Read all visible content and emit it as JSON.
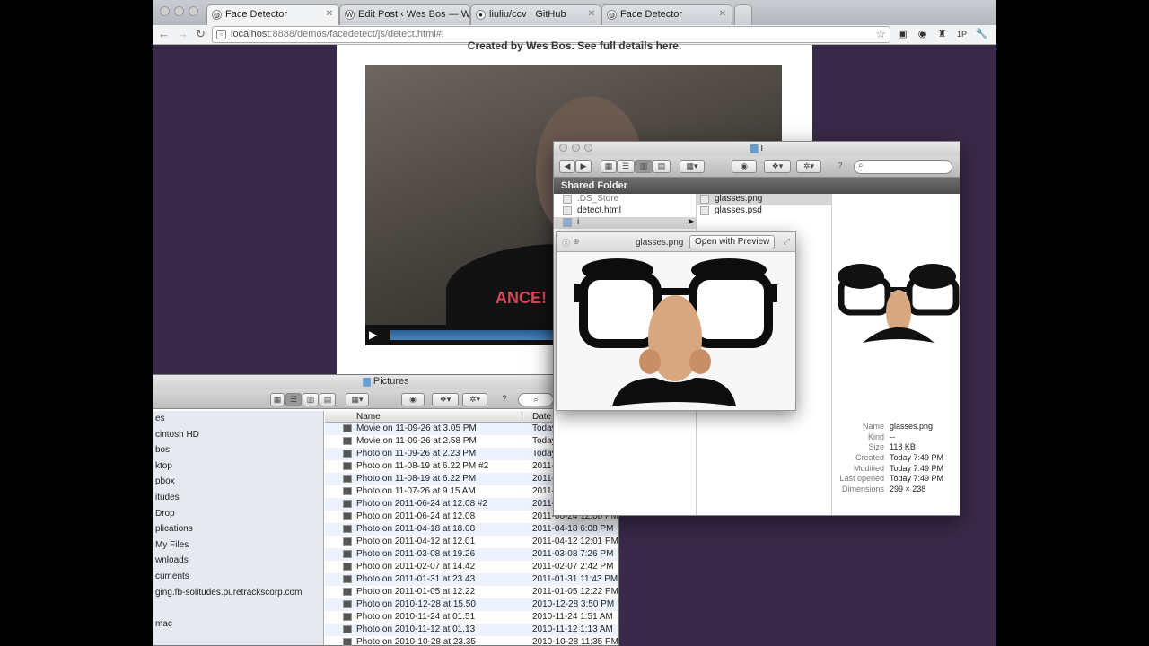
{
  "browser": {
    "tabs": [
      {
        "title": "Face Detector",
        "icon": "globe-icon"
      },
      {
        "title": "Edit Post ‹ Wes Bos — WordPress",
        "icon": "wordpress-icon"
      },
      {
        "title": "liuliu/ccv · GitHub",
        "icon": "github-icon"
      },
      {
        "title": "Face Detector",
        "icon": "globe-icon"
      }
    ],
    "url_host": "localhost",
    "url_rest": ":8888/demos/facedetect/js/detect.html#!"
  },
  "page": {
    "credit": "Created by Wes Bos. See full details here."
  },
  "video": {
    "shirt_text": "ANCE!",
    "progress": 0
  },
  "shared_finder": {
    "title": "i",
    "header": "Shared Folder",
    "col1": [
      ".DS_Store",
      "detect.html",
      "i"
    ],
    "col2": [
      "glasses.png",
      "glasses.psd"
    ],
    "meta": [
      {
        "k": "Name",
        "v": "glasses.png"
      },
      {
        "k": "Kind",
        "v": "--"
      },
      {
        "k": "Size",
        "v": "118 KB"
      },
      {
        "k": "Created",
        "v": "Today 7:49 PM"
      },
      {
        "k": "Modified",
        "v": "Today 7:49 PM"
      },
      {
        "k": "Last opened",
        "v": "Today 7:49 PM"
      },
      {
        "k": "Dimensions",
        "v": "299 × 238"
      }
    ]
  },
  "quicklook": {
    "filename": "glasses.png",
    "open_label": "Open with Preview"
  },
  "pictures": {
    "title": "Pictures",
    "sidebar": [
      "es",
      "cintosh HD",
      "bos",
      "ktop",
      "pbox",
      "itudes",
      "Drop",
      "plications",
      "My Files",
      "wnloads",
      "cuments",
      "ging.fb-solitudes.puretrackscorp.com",
      "",
      "mac"
    ],
    "col_name": "Name",
    "col_date": "Date",
    "files": [
      {
        "name": "Movie on 11-09-26 at 3.05 PM",
        "date": "Today"
      },
      {
        "name": "Movie on 11-09-26 at 2.58 PM",
        "date": "Today"
      },
      {
        "name": "Photo on 11-09-26 at 2.23 PM",
        "date": "Today"
      },
      {
        "name": "Photo on 11-08-19 at 6.22 PM #2",
        "date": "2011-"
      },
      {
        "name": "Photo on 11-08-19 at 6.22 PM",
        "date": "2011-"
      },
      {
        "name": "Photo on 11-07-26 at 9.15 AM",
        "date": "2011-"
      },
      {
        "name": "Photo on 2011-06-24 at 12.08 #2",
        "date": "2011-"
      },
      {
        "name": "Photo on 2011-06-24 at 12.08",
        "date": "2011-06-24 12:08 PM"
      },
      {
        "name": "Photo on 2011-04-18 at 18.08",
        "date": "2011-04-18 6:08 PM"
      },
      {
        "name": "Photo on 2011-04-12 at 12.01",
        "date": "2011-04-12 12:01 PM"
      },
      {
        "name": "Photo on 2011-03-08 at 19.26",
        "date": "2011-03-08 7:26 PM"
      },
      {
        "name": "Photo on 2011-02-07 at 14.42",
        "date": "2011-02-07 2:42 PM"
      },
      {
        "name": "Photo on 2011-01-31 at 23.43",
        "date": "2011-01-31 11:43 PM"
      },
      {
        "name": "Photo on 2011-01-05 at 12.22",
        "date": "2011-01-05 12:22 PM"
      },
      {
        "name": "Photo on 2010-12-28 at 15.50",
        "date": "2010-12-28 3:50 PM"
      },
      {
        "name": "Photo on 2010-11-24 at 01.51",
        "date": "2010-11-24 1:51 AM"
      },
      {
        "name": "Photo on 2010-11-12 at 01.13",
        "date": "2010-11-12 1:13 AM"
      },
      {
        "name": "Photo on 2010-10-28 at 23.35",
        "date": "2010-10-28 11:35 PM"
      }
    ]
  },
  "colors": {
    "desktop": "#3a2a4a",
    "progress": "#3d74ad",
    "selection": "#d6d6d6"
  }
}
